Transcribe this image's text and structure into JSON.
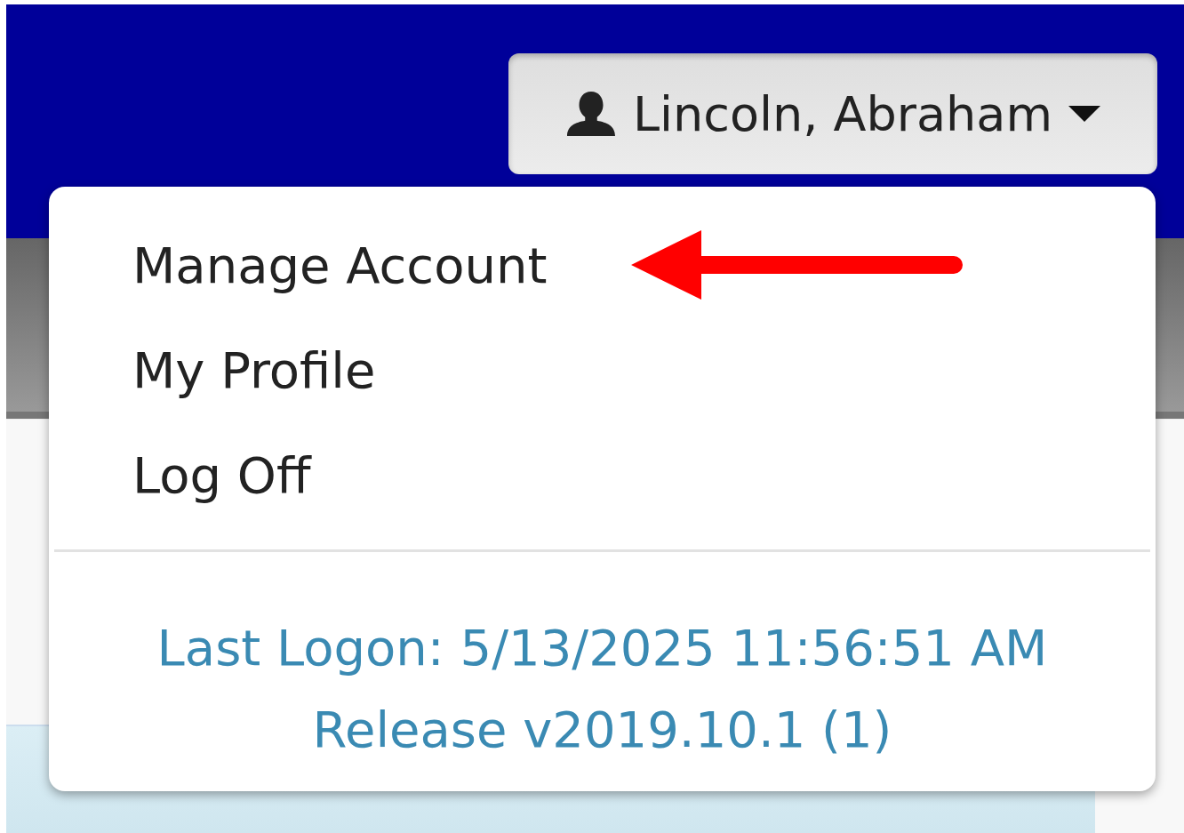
{
  "user_menu": {
    "user_name": "Lincoln, Abraham",
    "expanded": true,
    "items": [
      {
        "label": "Manage Account"
      },
      {
        "label": "My Profile"
      },
      {
        "label": "Log Off"
      }
    ],
    "last_logon": "Last Logon: 5/13/2025 11:56:51 AM",
    "release": "Release v2019.10.1 (1)"
  }
}
